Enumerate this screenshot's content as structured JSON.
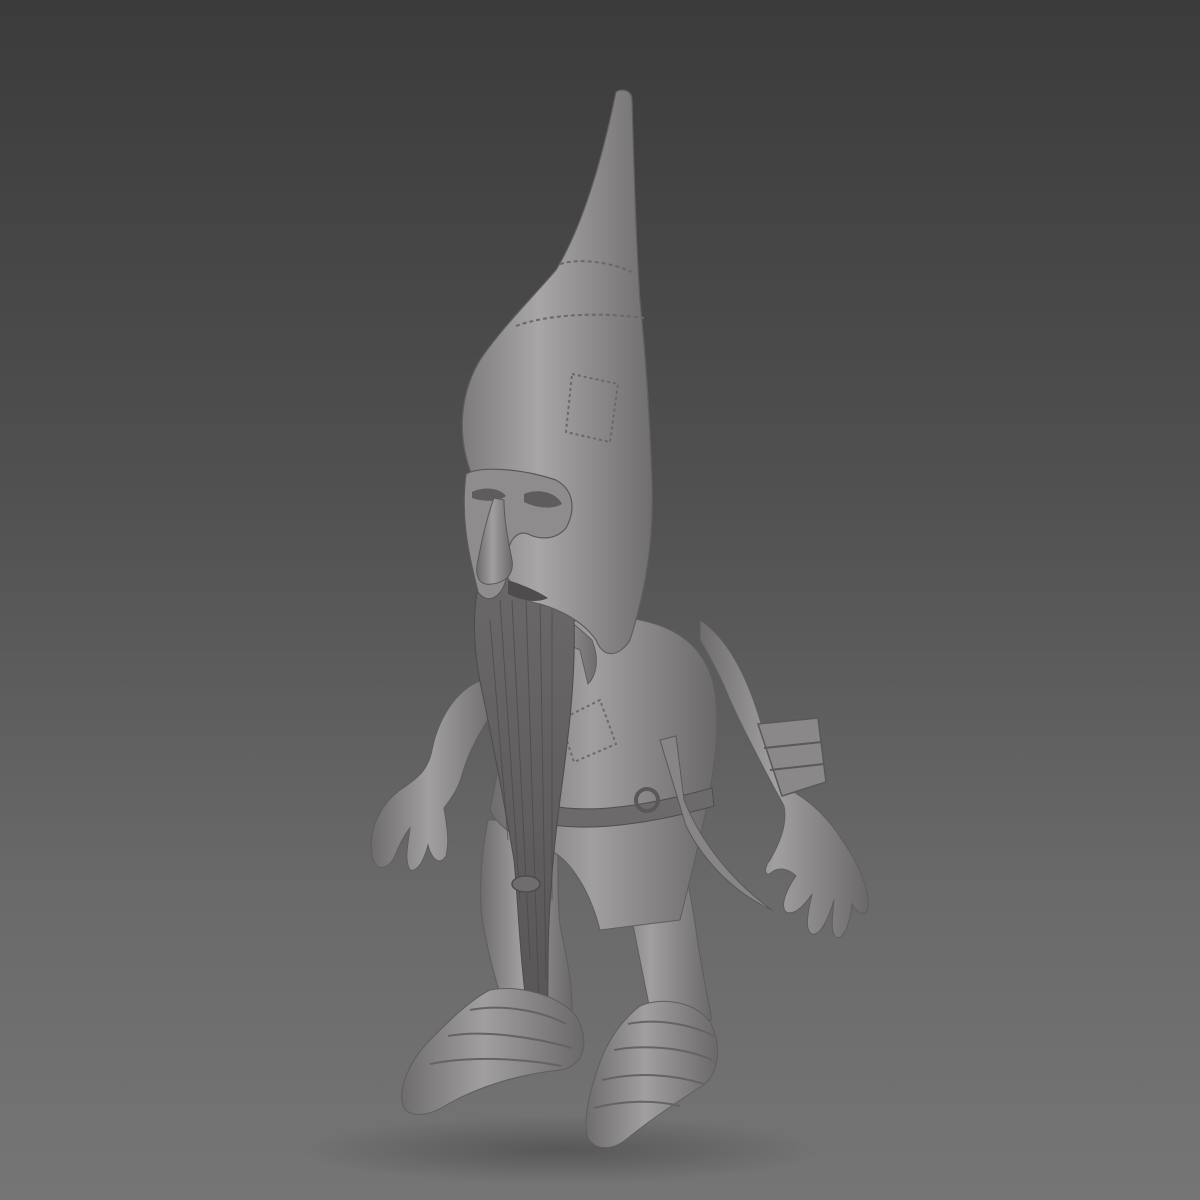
{
  "scene": {
    "background_top": "#3b3b3b",
    "background_bottom": "#757575",
    "material_color": "#8f8d8e",
    "subject": "gnome-sculpt"
  }
}
